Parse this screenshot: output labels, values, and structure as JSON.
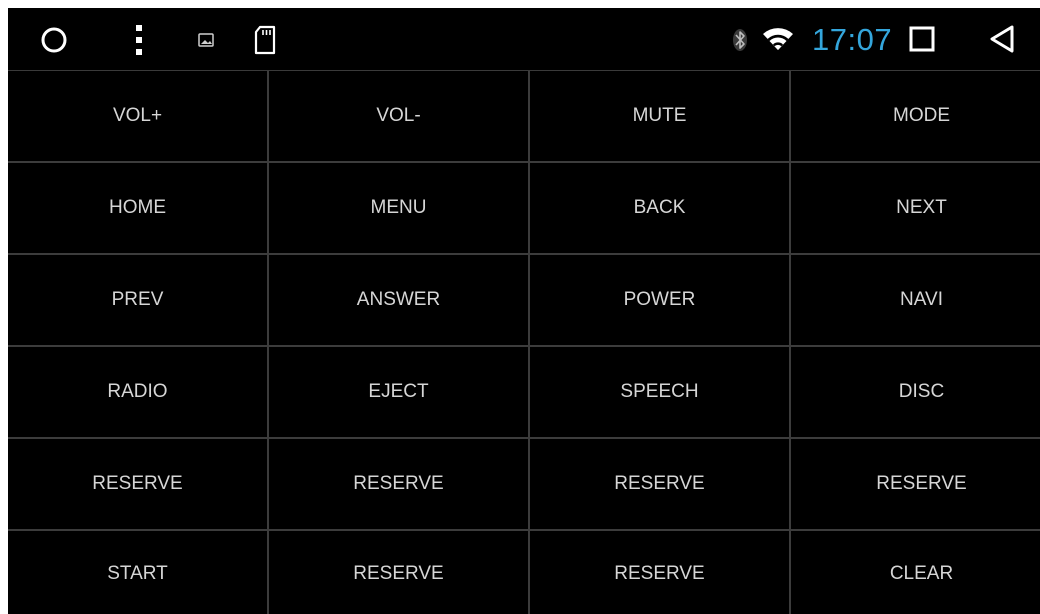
{
  "status_bar": {
    "time": "17:07",
    "icons": {
      "left": [
        "circle-home-icon",
        "overflow-menu-icon",
        "image-notification-icon",
        "sd-card-icon"
      ],
      "right": [
        "bluetooth-icon",
        "wifi-icon",
        "recents-square-icon",
        "back-triangle-icon"
      ]
    },
    "time_color": "#34a6dc"
  },
  "keypad": {
    "rows": [
      [
        "VOL+",
        "VOL-",
        "MUTE",
        "MODE"
      ],
      [
        "HOME",
        "MENU",
        "BACK",
        "NEXT"
      ],
      [
        "PREV",
        "ANSWER",
        "POWER",
        "NAVI"
      ],
      [
        "RADIO",
        "EJECT",
        "SPEECH",
        "DISC"
      ],
      [
        "RESERVE",
        "RESERVE",
        "RESERVE",
        "RESERVE"
      ],
      [
        "START",
        "RESERVE",
        "RESERVE",
        "CLEAR"
      ]
    ]
  },
  "colors": {
    "background": "#000000",
    "grid_line": "#3c3c3c",
    "key_text": "#d6d6d6"
  }
}
